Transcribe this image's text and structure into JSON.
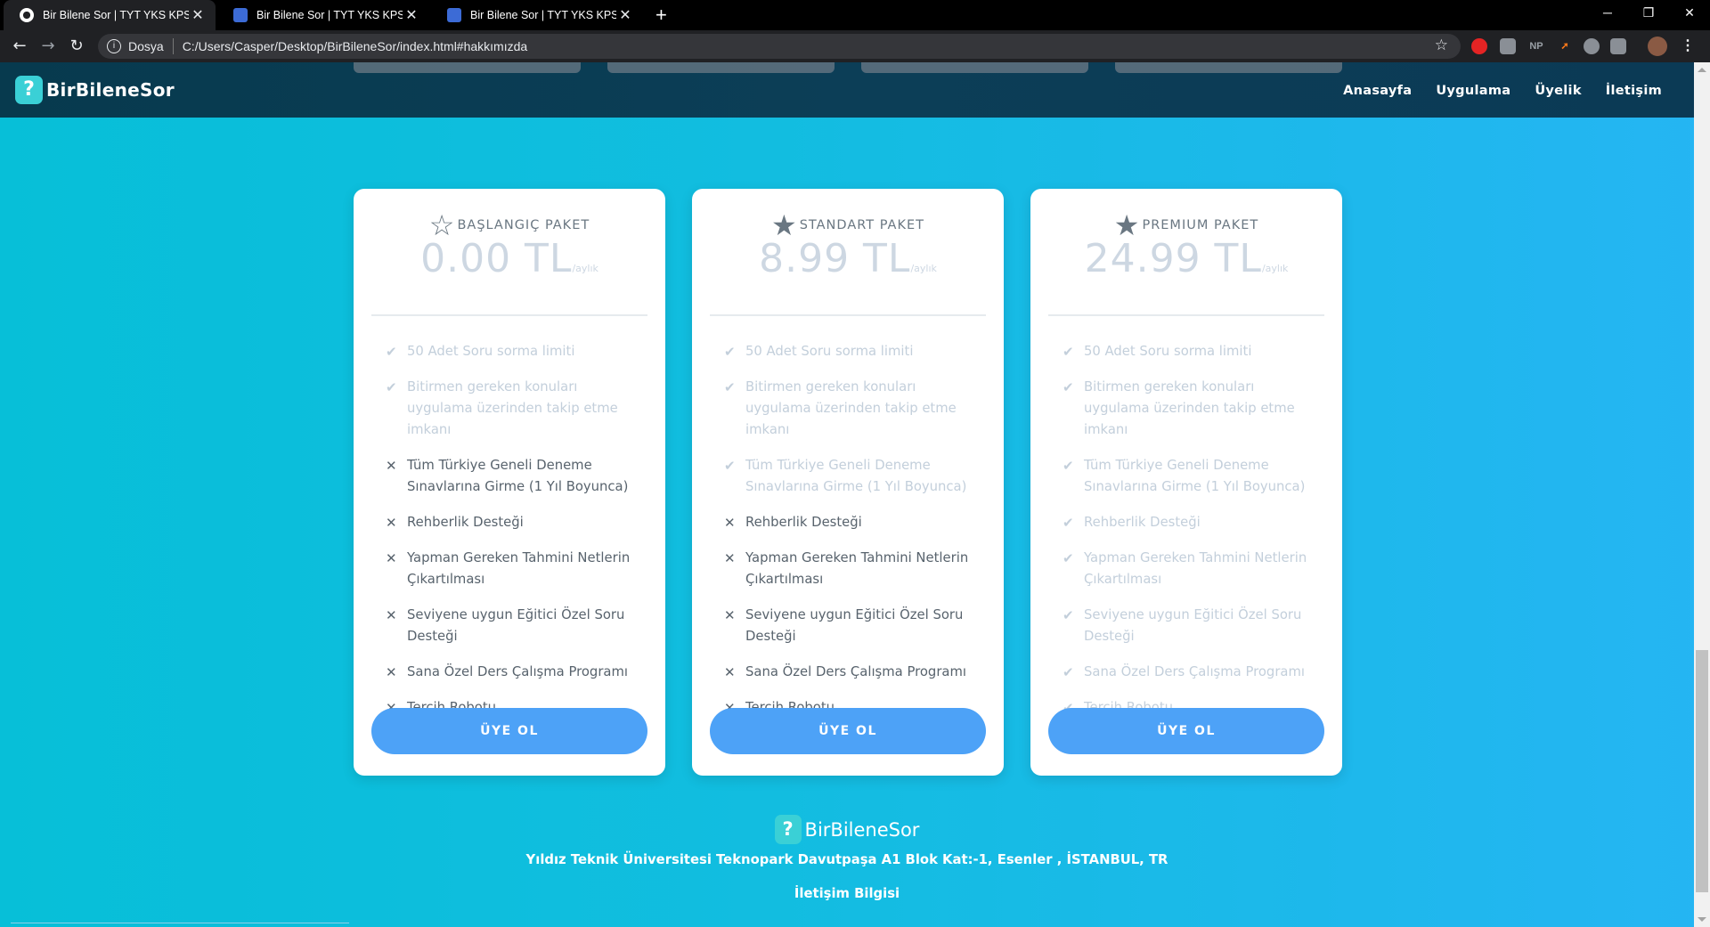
{
  "browser": {
    "tabs": [
      {
        "title": "Bir Bilene Sor | TYT YKS KPSS ALES",
        "active": true
      },
      {
        "title": "Bir Bilene Sor | TYT YKS KPSS ALES",
        "active": false
      },
      {
        "title": "Bir Bilene Sor | TYT YKS KPSS ALES",
        "active": false
      }
    ],
    "close_glyph": "✕",
    "newtab_glyph": "+",
    "site_label": "Dosya",
    "url": "C:/Users/Casper/Desktop/BirBileneSor/index.html#hakkımızda",
    "ext_np": "NP"
  },
  "site": {
    "logo_mark": "?",
    "logo_text": "BirBileneSor",
    "nav": [
      "Anasayfa",
      "Uygulama",
      "Üyelik",
      "İletişim"
    ]
  },
  "pricing": {
    "unit": "/aylık",
    "cta": "ÜYE OL",
    "feature_names": [
      "50 Adet Soru sorma limiti",
      "Bitirmen gereken konuları uygulama üzerinden takip etme imkanı",
      "Tüm Türkiye Geneli Deneme Sınavlarına Girme (1 Yıl Boyunca)",
      "Rehberlik Desteği",
      "Yapman Gereken Tahmini Netlerin Çıkartılması",
      "Seviyene uygun Eğitici Özel Soru Desteği",
      "Sana Özel Ders Çalışma Programı",
      "Tercih Robotu"
    ],
    "plans": [
      {
        "name": "BAŞLANGIÇ PAKET",
        "star": "empty",
        "price": "0.00 TL",
        "included": [
          true,
          true,
          false,
          false,
          false,
          false,
          false,
          false
        ]
      },
      {
        "name": "STANDART PAKET",
        "star": "half",
        "price": "8.99 TL",
        "included": [
          true,
          true,
          true,
          false,
          false,
          false,
          false,
          false
        ]
      },
      {
        "name": "PREMIUM PAKET",
        "star": "full",
        "price": "24.99 TL",
        "included": [
          true,
          true,
          true,
          true,
          true,
          true,
          true,
          true
        ]
      }
    ]
  },
  "footer": {
    "logo_text": "BirBileneSor",
    "address": "Yıldız Teknik Üniversitesi Teknopark Davutpaşa A1 Blok Kat:-1, Esenler , İSTANBUL, TR",
    "contact_link": "İletişim Bilgisi"
  },
  "colors": {
    "accent": "#4da2f7",
    "page_bg_start": "#07bfd8",
    "page_bg_end": "#25b5f3",
    "nav_bg": "#0c3e57"
  }
}
